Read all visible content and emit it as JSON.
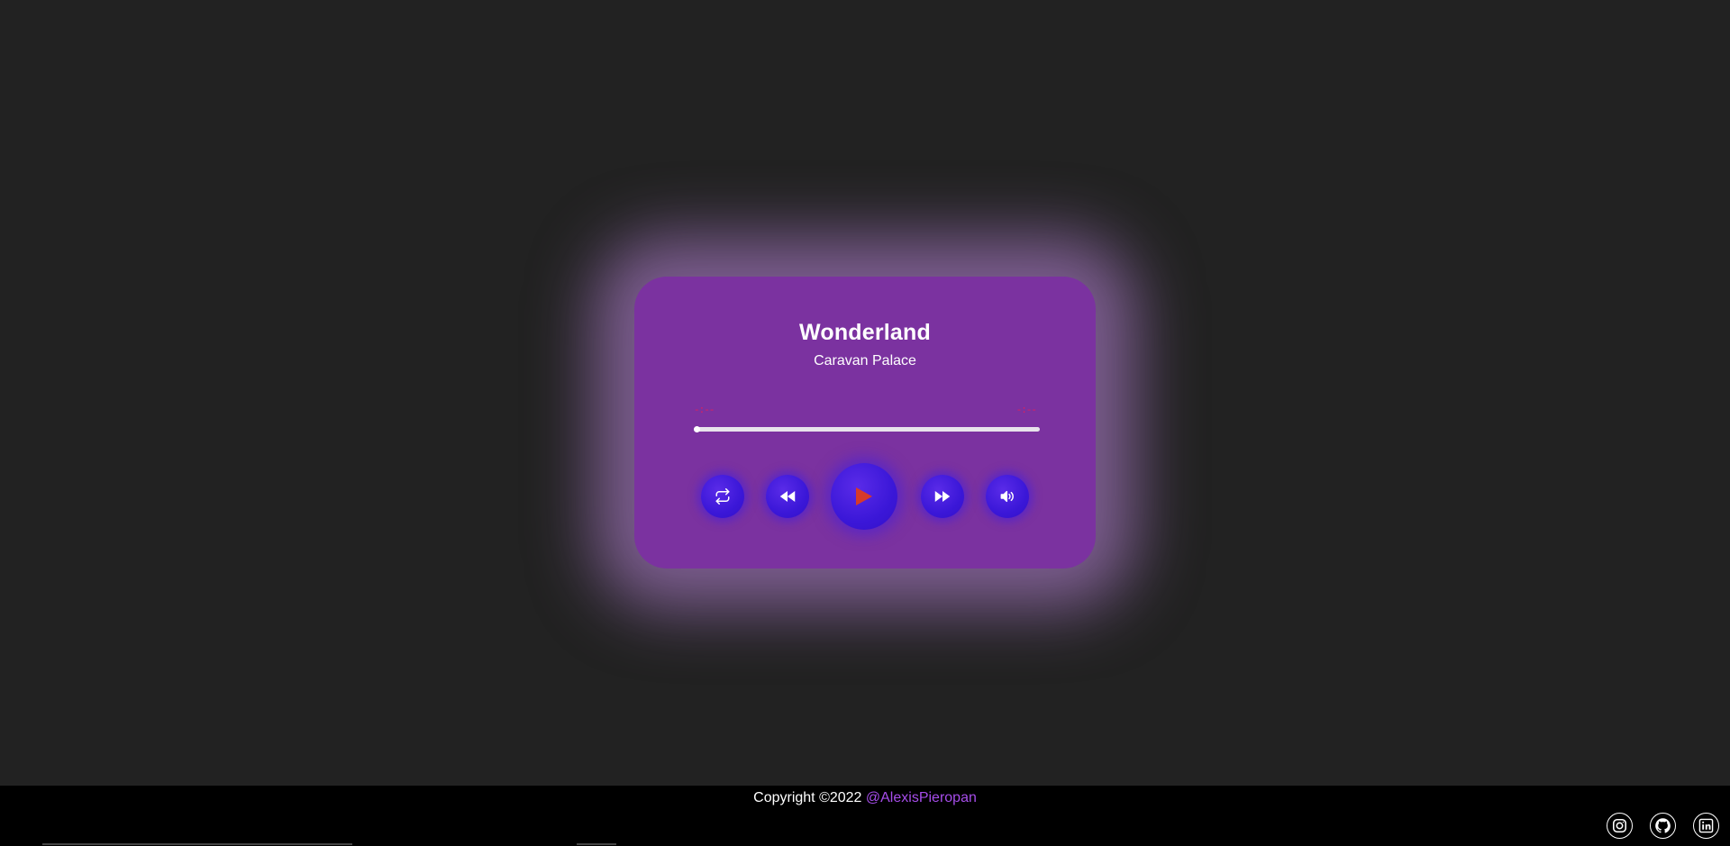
{
  "track": {
    "title": "Wonderland",
    "artist": "Caravan Palace",
    "current_time": "-:--",
    "duration": "-:--",
    "progress": 0.0
  },
  "controls": {
    "repeat_icon": "repeat-icon",
    "rewind_icon": "rewind-icon",
    "play_icon": "play-icon",
    "forward_icon": "fast-forward-icon",
    "volume_icon": "volume-icon"
  },
  "footer": {
    "copyright_text": "Copyright ©2022 ",
    "handle": "@AlexisPieropan",
    "socials": [
      "instagram-icon",
      "github-icon",
      "linkedin-icon"
    ]
  },
  "colors": {
    "background": "#222222",
    "card": "#7b32a0",
    "glow": "#c48ce8",
    "button": "#3b17d8",
    "play_triangle": "#d63a2a",
    "time_text": "#e0205a",
    "handle_link": "#a64dea",
    "footer": "#000000"
  }
}
